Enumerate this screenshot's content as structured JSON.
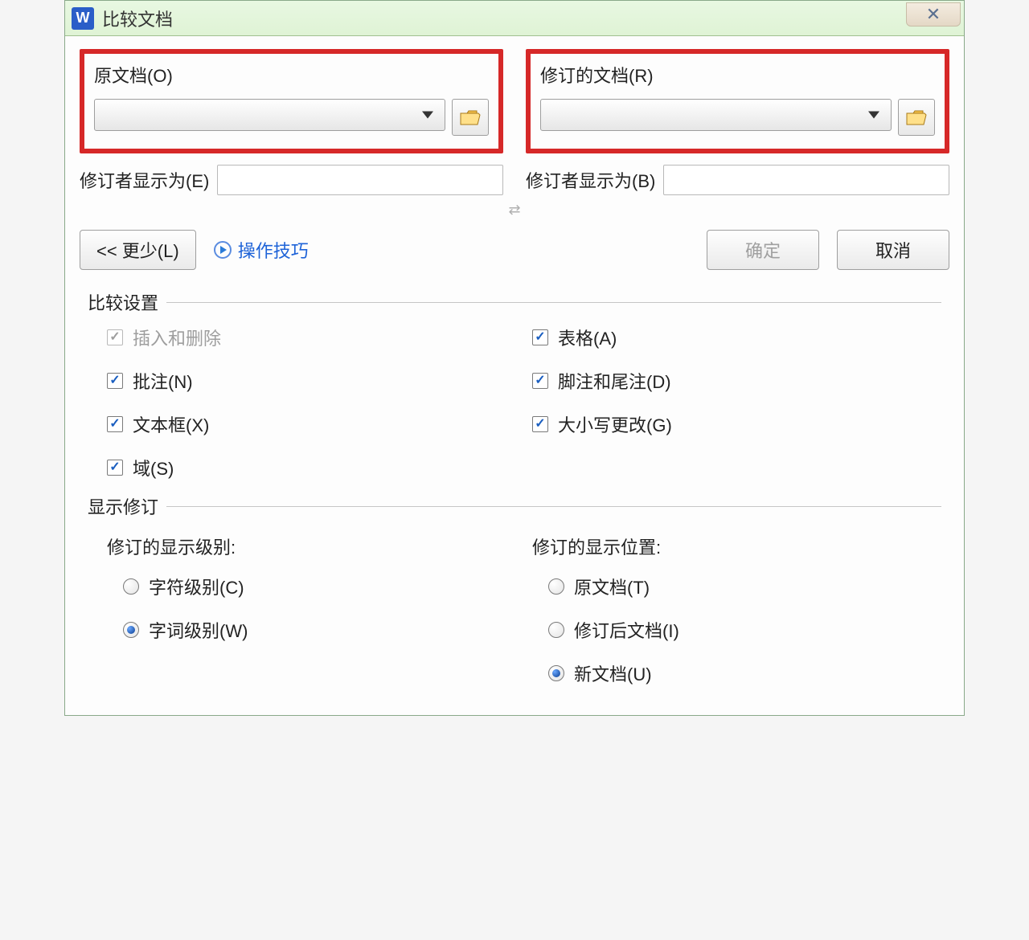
{
  "titlebar": {
    "app_icon_text": "W",
    "title": "比较文档",
    "close_glyph": "✕"
  },
  "original": {
    "section_label": "原文档(O)",
    "revisor_label": "修订者显示为(E)"
  },
  "revised": {
    "section_label": "修订的文档(R)",
    "revisor_label": "修订者显示为(B)"
  },
  "swap_glyph": "⇄",
  "buttons": {
    "less": "<< 更少(L)",
    "tips": "操作技巧",
    "ok": "确定",
    "cancel": "取消"
  },
  "compare_settings": {
    "header": "比较设置",
    "items_left": [
      {
        "label": "插入和删除",
        "checked": true,
        "disabled": true
      },
      {
        "label": "批注(N)",
        "checked": true,
        "disabled": false
      },
      {
        "label": "文本框(X)",
        "checked": true,
        "disabled": false
      },
      {
        "label": "域(S)",
        "checked": true,
        "disabled": false
      }
    ],
    "items_right": [
      {
        "label": "表格(A)",
        "checked": true,
        "disabled": false
      },
      {
        "label": "脚注和尾注(D)",
        "checked": true,
        "disabled": false
      },
      {
        "label": "大小写更改(G)",
        "checked": true,
        "disabled": false
      }
    ]
  },
  "show_changes": {
    "header": "显示修订",
    "level": {
      "label": "修订的显示级别:",
      "options": [
        {
          "label": "字符级别(C)",
          "selected": false
        },
        {
          "label": "字词级别(W)",
          "selected": true
        }
      ]
    },
    "location": {
      "label": "修订的显示位置:",
      "options": [
        {
          "label": "原文档(T)",
          "selected": false
        },
        {
          "label": "修订后文档(I)",
          "selected": false
        },
        {
          "label": "新文档(U)",
          "selected": true
        }
      ]
    }
  }
}
